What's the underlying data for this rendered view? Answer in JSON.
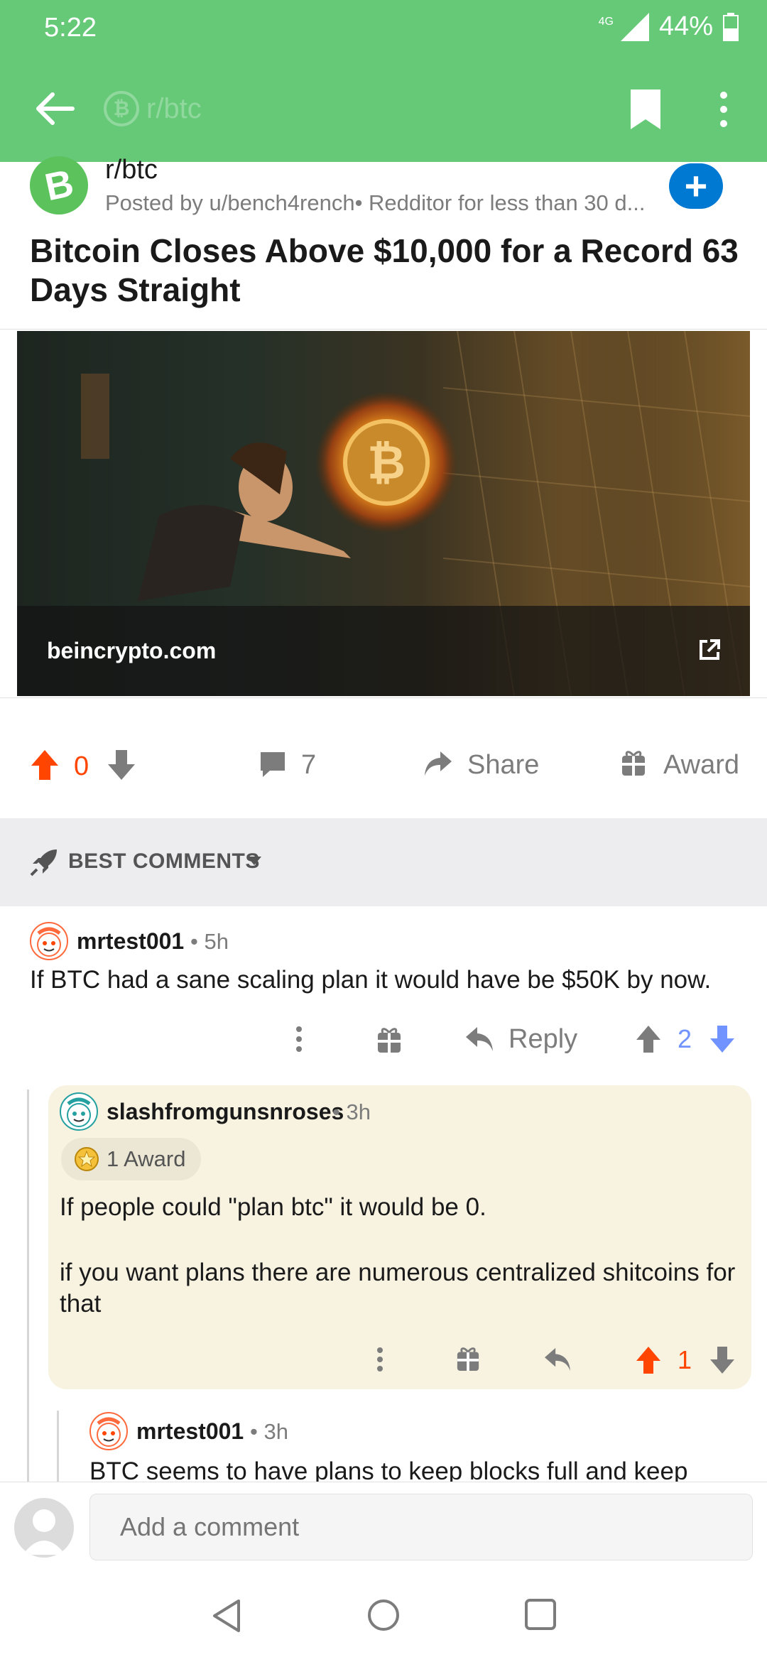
{
  "status_bar": {
    "time": "5:22",
    "network": "4G",
    "battery": "44%"
  },
  "app_bar": {
    "subreddit": "r/btc",
    "back_icon": "arrow-left-icon",
    "bookmark_icon": "bookmark-icon",
    "more_icon": "more-vertical-icon"
  },
  "post": {
    "subreddit": "r/btc",
    "subreddit_icon_letter": "B",
    "posted_by": "Posted by u/bench4rench• Redditor for less than 30 d...",
    "title": "Bitcoin Closes Above $10,000 for a Record 63 Days Straight",
    "link_domain": "beincrypto.com",
    "score": "0",
    "comments": "7",
    "share_label": "Share",
    "award_label": "Award"
  },
  "sort": {
    "label": "BEST COMMENTS"
  },
  "comments": [
    {
      "user": "mrtest001",
      "meta": "• 5h",
      "body": "If BTC had a sane scaling plan it would have be $50K by now.",
      "reply_label": "Reply",
      "score": "2"
    },
    {
      "user": "slashfromgunsnroses",
      "meta": "• 3h",
      "award": "1 Award",
      "body_p1": "If people could \"plan btc\" it would be 0.",
      "body_p2": "if you want plans there are numerous centralized shitcoins for that",
      "score": "1"
    },
    {
      "user": "mrtest001",
      "meta": "• 3h",
      "body": "BTC seems to have plans to keep blocks full and keep"
    }
  ],
  "composer": {
    "placeholder": "Add a comment"
  },
  "colors": {
    "app_green": "#66c978",
    "upvote_orange": "#ff4500",
    "downvote_blue": "#7193ff",
    "join_blue": "#0079d3",
    "reply_card_bg": "#f8f3e1"
  }
}
